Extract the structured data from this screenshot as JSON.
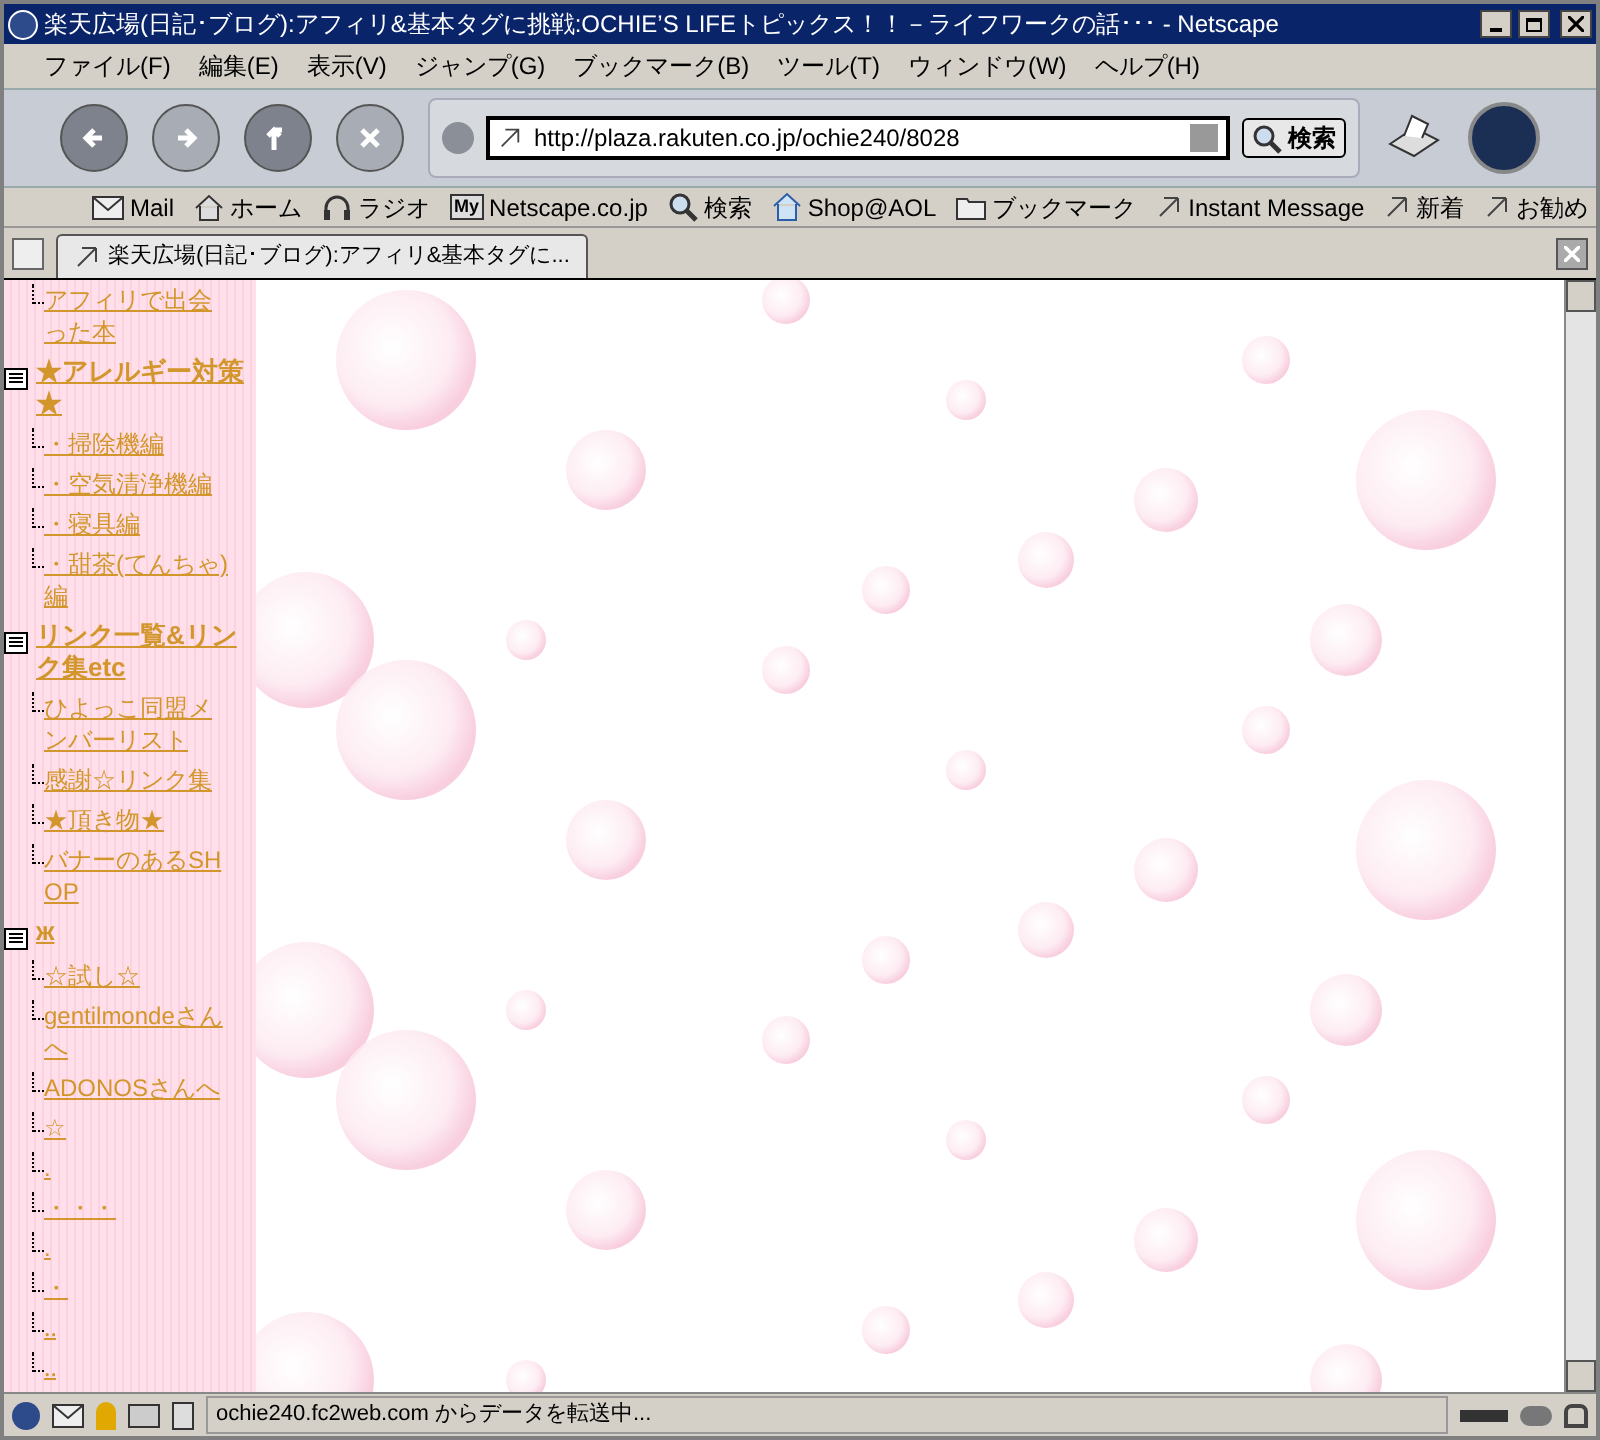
{
  "window": {
    "title": "楽天広場(日記･ブログ):アフィリ&基本タグに挑戦:OCHIE’S LIFEトピックス！！－ライフワークの話･･･ - Netscape"
  },
  "menu": [
    "ファイル(F)",
    "編集(E)",
    "表示(V)",
    "ジャンプ(G)",
    "ブックマーク(B)",
    "ツール(T)",
    "ウィンドウ(W)",
    "ヘルプ(H)"
  ],
  "navigation": {
    "url": "http://plaza.rakuten.co.jp/ochie240/8028",
    "search_button": "検索"
  },
  "personal_toolbar": [
    {
      "kind": "mail",
      "label": "Mail"
    },
    {
      "kind": "home",
      "label": "ホーム"
    },
    {
      "kind": "radio",
      "label": "ラジオ"
    },
    {
      "kind": "my",
      "badge": "My",
      "label": "Netscape.co.jp"
    },
    {
      "kind": "search",
      "label": "検索"
    },
    {
      "kind": "shop",
      "label": "Shop@AOL"
    },
    {
      "kind": "folder",
      "label": "ブックマーク"
    },
    {
      "kind": "link",
      "label": "Instant Message"
    },
    {
      "kind": "link",
      "label": "新着"
    },
    {
      "kind": "link",
      "label": "お勧め"
    }
  ],
  "tabs": [
    {
      "label": "楽天広場(日記･ブログ):アフィリ&基本タグに...",
      "selected": true
    }
  ],
  "sidebar": {
    "tree": [
      {
        "children": [
          {
            "label": "アフィリで出会った本"
          }
        ]
      },
      {
        "label": "★アレルギー対策★",
        "children": [
          {
            "label": "・掃除機編"
          },
          {
            "label": "・空気清浄機編"
          },
          {
            "label": "・寝具編"
          },
          {
            "label": "・甜茶(てんちゃ)編"
          }
        ]
      },
      {
        "label": "リンク一覧&リンク集etc",
        "children": [
          {
            "label": "ひよっこ同盟メンバーリスト"
          },
          {
            "label": "感謝☆リンク集"
          },
          {
            "label": "★頂き物★"
          },
          {
            "label": "バナーのあるSHOP"
          }
        ]
      },
      {
        "label": "ж",
        "children": [
          {
            "label": "☆試し☆"
          },
          {
            "label": "gentilmondeさんへ"
          },
          {
            "label": "ADONOSさんへ"
          },
          {
            "label": "☆"
          },
          {
            "label": "."
          },
          {
            "label": "・・・"
          },
          {
            "label": "."
          },
          {
            "label": "・"
          },
          {
            "label": "‥"
          },
          {
            "label": "‥"
          }
        ]
      }
    ]
  },
  "status_bar": {
    "text": "ochie240.fc2web.com からデータを転送中..."
  }
}
